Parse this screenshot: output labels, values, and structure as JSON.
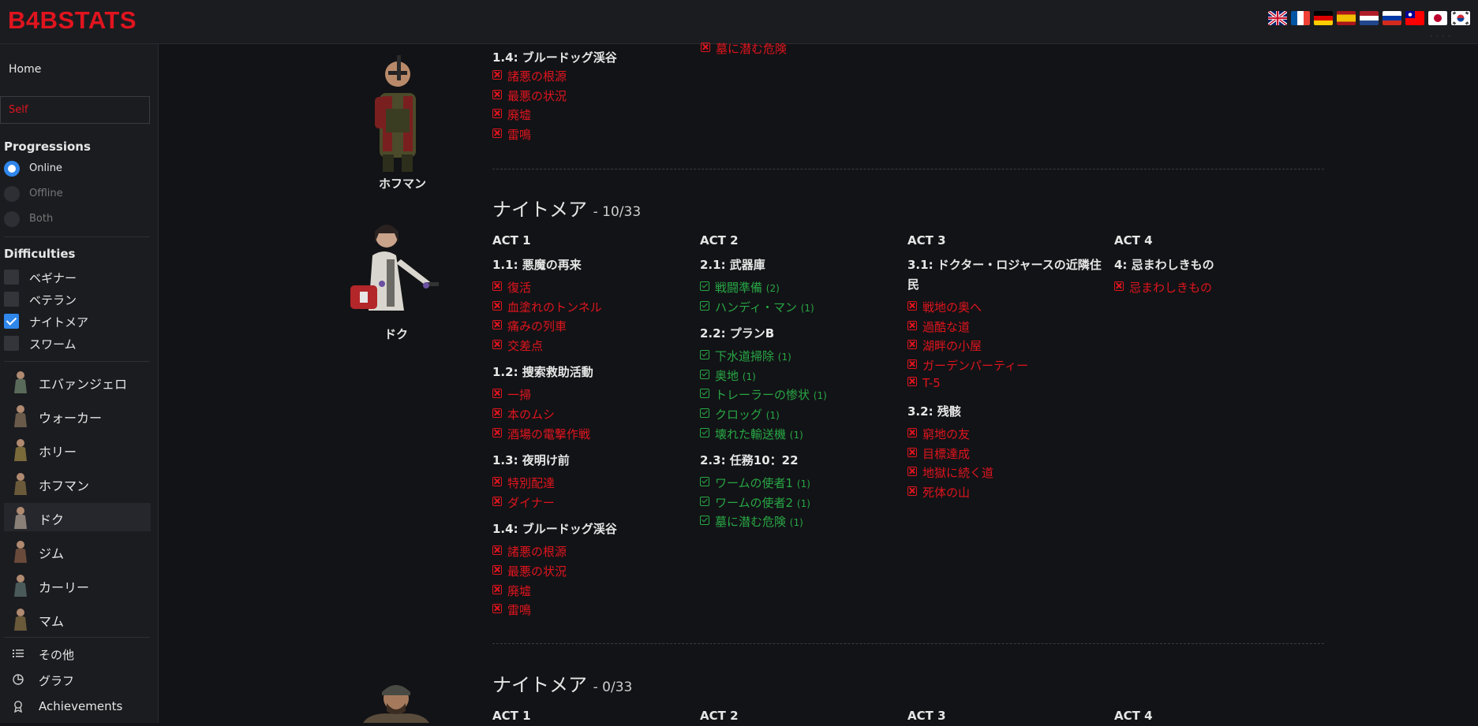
{
  "header": {
    "logo": "B4BSTATS",
    "lang_more": "· · · ·"
  },
  "sidebar": {
    "home": "Home",
    "self": "Self",
    "progressions": {
      "title": "Progressions",
      "options": [
        "Online",
        "Offline",
        "Both"
      ],
      "selected": "Online"
    },
    "difficulties": {
      "title": "Difficulties",
      "options": [
        "ベギナー",
        "ベテラン",
        "ナイトメア",
        "スワーム"
      ],
      "checked": [
        "ナイトメア"
      ]
    },
    "characters": [
      "エバァンジェロ",
      "ウォーカー",
      "ホリー",
      "ホフマン",
      "ドク",
      "ジム",
      "カーリー",
      "マム"
    ],
    "active_character": "ドク",
    "misc": [
      {
        "icon": "list-icon",
        "label": "その他"
      },
      {
        "icon": "pie-chart-icon",
        "label": "グラフ"
      },
      {
        "icon": "award-icon",
        "label": "Achievements"
      }
    ]
  },
  "top_section": {
    "character": "ホフマン",
    "chapter": "1.4: ブルードッグ渓谷",
    "items": [
      "諸悪の根源",
      "最悪の状況",
      "廃墟",
      "雷鳴"
    ],
    "cut_item": "墓に潜む危険"
  },
  "doc_section": {
    "character": "ドク",
    "title": "ナイトメア",
    "count": "- 10/33",
    "acts": [
      {
        "label": "ACT 1",
        "chapters": [
          {
            "name": "1.1: 悪魔の再来",
            "items": [
              {
                "t": "復活",
                "s": "fail"
              },
              {
                "t": "血塗れのトンネル",
                "s": "fail"
              },
              {
                "t": "痛みの列車",
                "s": "fail"
              },
              {
                "t": "交差点",
                "s": "fail"
              }
            ]
          },
          {
            "name": "1.2: 捜索救助活動",
            "items": [
              {
                "t": "一掃",
                "s": "fail"
              },
              {
                "t": "本のムシ",
                "s": "fail"
              },
              {
                "t": "酒場の電撃作戦",
                "s": "fail"
              }
            ]
          },
          {
            "name": "1.3: 夜明け前",
            "items": [
              {
                "t": "特別配達",
                "s": "fail"
              },
              {
                "t": "ダイナー",
                "s": "fail"
              }
            ]
          },
          {
            "name": "1.4: ブルードッグ渓谷",
            "items": [
              {
                "t": "諸悪の根源",
                "s": "fail"
              },
              {
                "t": "最悪の状況",
                "s": "fail"
              },
              {
                "t": "廃墟",
                "s": "fail"
              },
              {
                "t": "雷鳴",
                "s": "fail"
              }
            ]
          }
        ]
      },
      {
        "label": "ACT 2",
        "chapters": [
          {
            "name": "2.1: 武器庫",
            "items": [
              {
                "t": "戦闘準備",
                "c": "(2)",
                "s": "ok"
              },
              {
                "t": "ハンディ・マン",
                "c": "(1)",
                "s": "ok"
              }
            ]
          },
          {
            "name": "2.2: プランB",
            "items": [
              {
                "t": "下水道掃除",
                "c": "(1)",
                "s": "ok"
              },
              {
                "t": "奥地",
                "c": "(1)",
                "s": "ok"
              },
              {
                "t": "トレーラーの惨状",
                "c": "(1)",
                "s": "ok"
              },
              {
                "t": "クロッグ",
                "c": "(1)",
                "s": "ok"
              },
              {
                "t": "壊れた輸送機",
                "c": "(1)",
                "s": "ok"
              }
            ]
          },
          {
            "name": "2.3: 任務10：22",
            "items": [
              {
                "t": "ワームの使者1",
                "c": "(1)",
                "s": "ok"
              },
              {
                "t": "ワームの使者2",
                "c": "(1)",
                "s": "ok"
              },
              {
                "t": "墓に潜む危険",
                "c": "(1)",
                "s": "ok"
              }
            ]
          }
        ]
      },
      {
        "label": "ACT 3",
        "chapters": [
          {
            "name": "3.1: ドクター・ロジャースの近隣住民",
            "items": [
              {
                "t": "戦地の奥へ",
                "s": "fail"
              },
              {
                "t": "過酷な道",
                "s": "fail"
              },
              {
                "t": "湖畔の小屋",
                "s": "fail"
              },
              {
                "t": "ガーデンパーティー",
                "s": "fail"
              },
              {
                "t": "T-5",
                "s": "fail"
              }
            ]
          },
          {
            "name": "3.2: 残骸",
            "items": [
              {
                "t": "窮地の友",
                "s": "fail"
              },
              {
                "t": "目標達成",
                "s": "fail"
              },
              {
                "t": "地獄に続く道",
                "s": "fail"
              },
              {
                "t": "死体の山",
                "s": "fail"
              }
            ]
          }
        ]
      },
      {
        "label": "ACT 4",
        "chapters": [
          {
            "name": "4: 忌まわしきもの",
            "items": [
              {
                "t": "忌まわしきもの",
                "s": "fail"
              }
            ]
          }
        ]
      }
    ]
  },
  "next_section": {
    "title": "ナイトメア",
    "count": "- 0/33",
    "acts": [
      "ACT 1",
      "ACT 2",
      "ACT 3",
      "ACT 4"
    ]
  },
  "colors": {
    "fail": "#e0141e",
    "ok": "#28a745",
    "accent": "#2f86eb",
    "logo": "#e0141e"
  }
}
